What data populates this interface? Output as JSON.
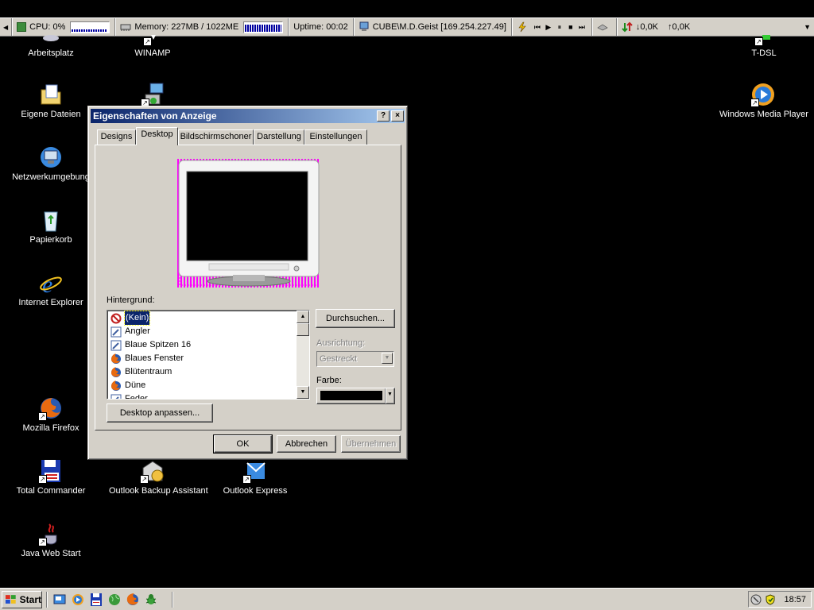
{
  "statusbar": {
    "cpu": "CPU: 0%",
    "memory": "Memory: 227MB / 1022ME",
    "uptime": "Uptime: 00:02",
    "network": "CUBE\\M.D.Geist [169.254.227.49]",
    "down": "0,0K",
    "up": "0,0K"
  },
  "desktop": {
    "icons": [
      {
        "label": "Arbeitsplatz"
      },
      {
        "label": "WINAMP"
      },
      {
        "label": "T-DSL"
      },
      {
        "label": "Eigene Dateien"
      },
      {
        "label": "Windows Media Player"
      },
      {
        "label": "Netzwerkumgebung"
      },
      {
        "label": "Papierkorb"
      },
      {
        "label": "Internet Explorer"
      },
      {
        "label": "Mozilla Firefox"
      },
      {
        "label": "Total Commander"
      },
      {
        "label": "Outlook Backup Assistant"
      },
      {
        "label": "Outlook Express"
      },
      {
        "label": "Java Web Start"
      }
    ]
  },
  "dialog": {
    "title": "Eigenschaften von Anzeige",
    "help": "?",
    "close": "×",
    "tabs": [
      "Designs",
      "Desktop",
      "Bildschirmschoner",
      "Darstellung",
      "Einstellungen"
    ],
    "active_tab": "Desktop",
    "background_label": "Hintergrund:",
    "backgrounds": [
      "(Kein)",
      "Angler",
      "Blaue Spitzen 16",
      "Blaues Fenster",
      "Blütentraum",
      "Düne",
      "Feder"
    ],
    "selected_background": "(Kein)",
    "browse_button": "Durchsuchen...",
    "position_label": "Ausrichtung:",
    "position_value": "Gestreckt",
    "color_label": "Farbe:",
    "color_value": "#000000",
    "customize_button": "Desktop anpassen...",
    "ok_button": "OK",
    "cancel_button": "Abbrechen",
    "apply_button": "Übernehmen"
  },
  "taskbar": {
    "start": "Start",
    "clock": "18:57"
  }
}
